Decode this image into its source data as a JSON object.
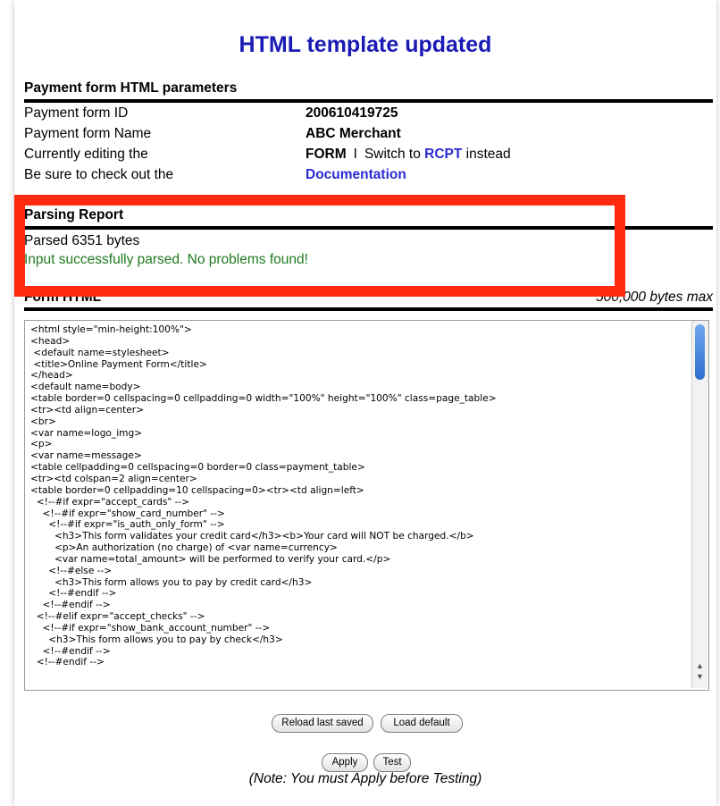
{
  "title": "HTML template updated",
  "params": {
    "heading": "Payment form HTML parameters",
    "form_id_label": "Payment form ID",
    "form_id_value": "200610419725",
    "form_name_label": "Payment form Name",
    "form_name_value": "ABC Merchant",
    "editing_label": "Currently editing the",
    "editing_value": "FORM",
    "separator": "I",
    "switch_prefix": "Switch to",
    "switch_link": "RCPT",
    "switch_suffix": "instead",
    "check_label": "Be sure to check out the",
    "doc_link": "Documentation"
  },
  "report": {
    "heading": "Parsing Report",
    "bytes": "Parsed 6351 bytes",
    "status": "Input successfully parsed. No problems found!"
  },
  "form_html": {
    "heading": "Form HTML",
    "max": "500,000 bytes max",
    "content": "<html style=\"min-height:100%\">\n<head>\n <default name=stylesheet>\n <title>Online Payment Form</title>\n</head>\n<default name=body>\n<table border=0 cellspacing=0 cellpadding=0 width=\"100%\" height=\"100%\" class=page_table>\n<tr><td align=center>\n<br>\n<var name=logo_img>\n<p>\n<var name=message>\n<table cellpadding=0 cellspacing=0 border=0 class=payment_table>\n<tr><td colspan=2 align=center>\n<table border=0 cellpadding=10 cellspacing=0><tr><td align=left>\n  <!--#if expr=\"accept_cards\" -->\n    <!--#if expr=\"show_card_number\" -->\n      <!--#if expr=\"is_auth_only_form\" -->\n        <h3>This form validates your credit card</h3><b>Your card will NOT be charged.</b>\n        <p>An authorization (no charge) of <var name=currency>\n        <var name=total_amount> will be performed to verify your card.</p>\n      <!--#else -->\n        <h3>This form allows you to pay by credit card</h3>\n      <!--#endif -->\n    <!--#endif -->\n  <!--#elif expr=\"accept_checks\" -->\n    <!--#if expr=\"show_bank_account_number\" -->\n      <h3>This form allows you to pay by check</h3>\n    <!--#endif -->\n  <!--#endif -->"
  },
  "buttons": {
    "reload": "Reload last saved",
    "load_default": "Load default",
    "apply": "Apply",
    "test": "Test"
  },
  "note": "(Note: You must Apply before Testing)",
  "colors": {
    "title": "#1a1ab5",
    "link": "#2b2bd6",
    "success": "#1e7a1e",
    "highlight": "#ff2a10"
  }
}
